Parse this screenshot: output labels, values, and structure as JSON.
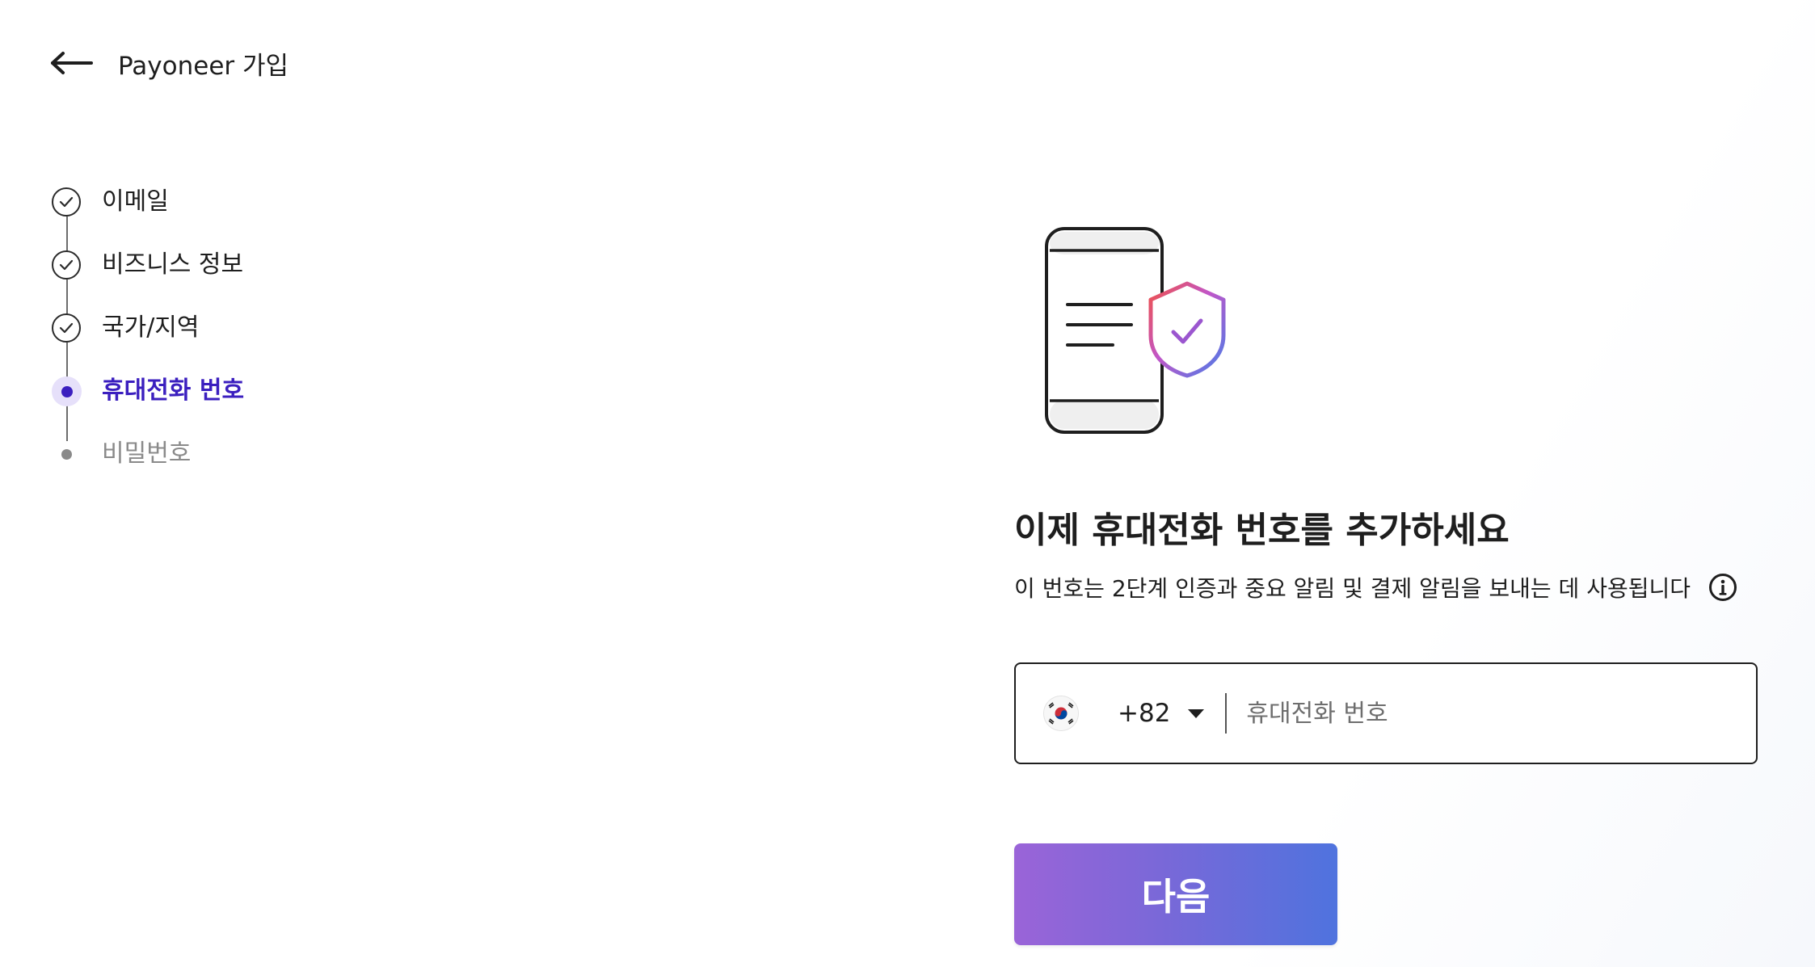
{
  "header": {
    "title": "Payoneer 가입",
    "back_icon": "arrow-left-icon"
  },
  "stepper": {
    "steps": [
      {
        "label": "이메일",
        "status": "completed"
      },
      {
        "label": "비즈니스 정보",
        "status": "completed"
      },
      {
        "label": "국가/지역",
        "status": "completed"
      },
      {
        "label": "휴대전화 번호",
        "status": "active"
      },
      {
        "label": "비밀번호",
        "status": "pending"
      }
    ]
  },
  "illustration": {
    "icon": "phone-shield-check-icon"
  },
  "main": {
    "title": "이제 휴대전화 번호를 추가하세요",
    "subtitle": "이 번호는 2단계 인증과 중요 알림 및 결제 알림을 보내는 데 사용됩니다",
    "info_icon": "info-icon"
  },
  "phone": {
    "country_flag": "south-korea-flag-icon",
    "dial_code": "+82",
    "placeholder": "휴대전화 번호",
    "value": ""
  },
  "actions": {
    "next_label": "다음"
  },
  "colors": {
    "active_step": "#3b1fbf",
    "button_gradient_start": "#9a64d8",
    "button_gradient_end": "#4f73de"
  }
}
